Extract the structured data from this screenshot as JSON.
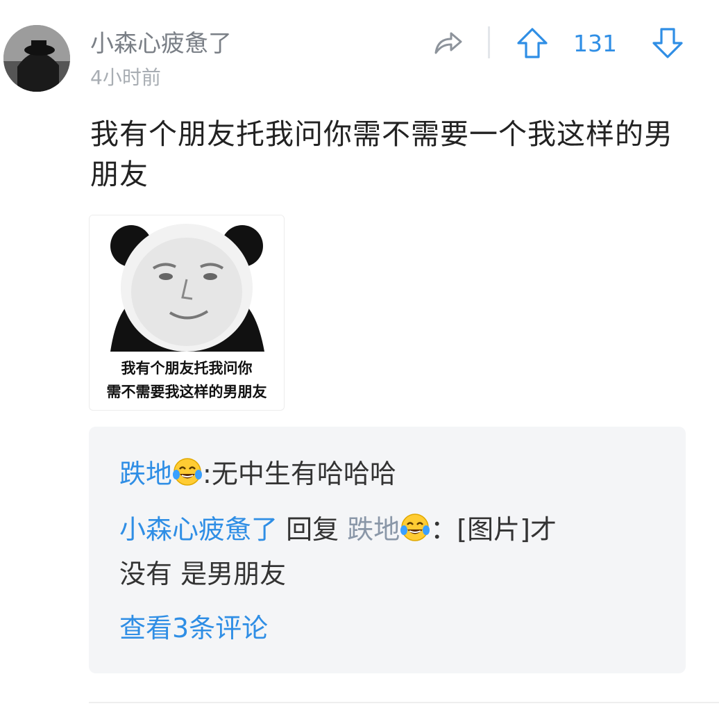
{
  "post": {
    "username": "小森心疲惫了",
    "time": "4小时前",
    "vote_count": "131",
    "content": "我有个朋友托我问你需不需要一个我这样的男朋友",
    "meme_caption_line1": "我有个朋友托我问你",
    "meme_caption_line2": "需不需要我这样的男朋友"
  },
  "replies": {
    "first": {
      "user": "跌地",
      "emoji": "laughing-tears-emoji",
      "separator": ":",
      "text": "无中生有哈哈哈"
    },
    "second": {
      "user": "小森心疲惫了",
      "reply_word": "回复",
      "target": "跌地",
      "emoji": "laughing-tears-emoji",
      "separator": "：",
      "text_line1": "[图片]才",
      "text_line2": "没有 是男朋友"
    },
    "view_more": "查看3条评论"
  },
  "colors": {
    "accent": "#2f8ee5",
    "reply_bg": "#f4f5f7"
  }
}
